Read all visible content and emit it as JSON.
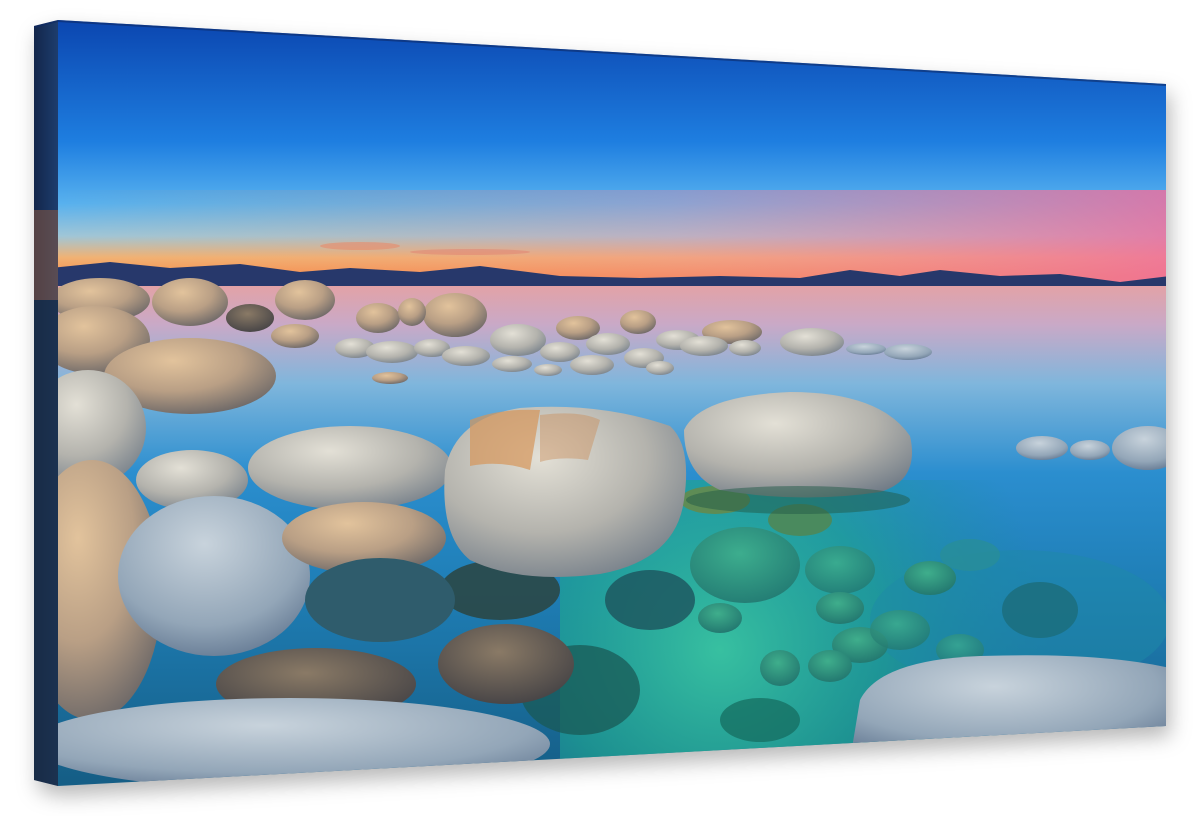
{
  "artwork": {
    "subject": "lake-shore-boulders-at-sunset",
    "format": "gallery-wrapped-canvas",
    "colors": {
      "sky_top": "#0f50b8",
      "sky_mid": "#2c8fe6",
      "horizon_glow": "#f6a15a",
      "horizon_pink": "#f07aa0",
      "water_far": "#d9a6b8",
      "water_mid": "#2f8fc9",
      "water_shallow": "#2aa590",
      "mountains": "#24376a",
      "boulder_light": "#b7b6b0",
      "boulder_warm": "#c9925c"
    }
  }
}
